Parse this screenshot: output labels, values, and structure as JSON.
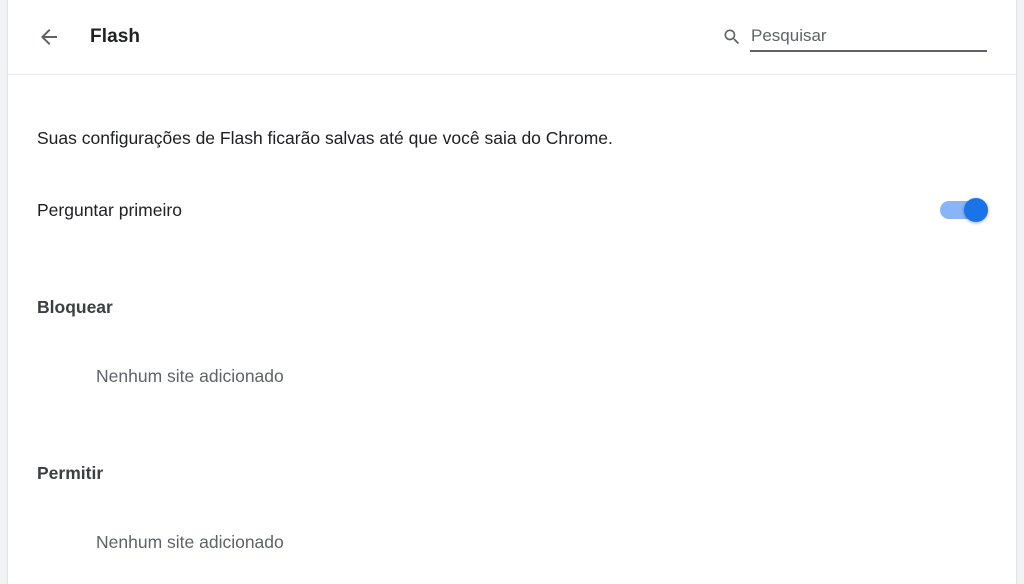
{
  "header": {
    "back_icon": "arrow-back-icon",
    "title": "Flash",
    "search": {
      "icon": "search-icon",
      "placeholder": "Pesquisar",
      "value": ""
    }
  },
  "info": {
    "text": "Suas configurações de Flash ficarão salvas até que você saia do Chrome."
  },
  "ask_first": {
    "label": "Perguntar primeiro",
    "enabled": true
  },
  "sections": {
    "block": {
      "heading": "Bloquear",
      "empty_text": "Nenhum site adicionado"
    },
    "allow": {
      "heading": "Permitir",
      "empty_text": "Nenhum site adicionado"
    }
  },
  "colors": {
    "accent": "#1a73e8",
    "toggle_track": "#8ab4f8"
  }
}
